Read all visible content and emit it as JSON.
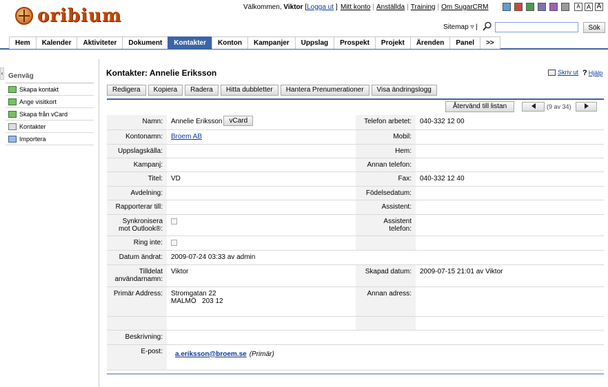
{
  "header": {
    "logo_text": "oribium",
    "welcome_prefix": "Välkommen,",
    "user": "Viktor",
    "logout_open": "[",
    "logout_label": "Logga ut",
    "logout_close": "]",
    "top_links": [
      "Mitt konto",
      "Anställda",
      "Training",
      "Om SugarCRM"
    ],
    "swatches": [
      "#5b9ed6",
      "#c9493f",
      "#4b9a4b",
      "#7e74b4",
      "#9c63b5",
      "#9a9a9a"
    ],
    "font_sizes": [
      "A",
      "A",
      "A"
    ],
    "sitemap_label": "Sitemap",
    "sitemap_arrow": "▿ |",
    "search_placeholder": "",
    "search_button": "Sök"
  },
  "tabs": [
    "Hem",
    "Kalender",
    "Aktiviteter",
    "Dokument",
    "Kontakter",
    "Konton",
    "Kampanjer",
    "Uppslag",
    "Prospekt",
    "Projekt",
    "Ärenden",
    "Panel",
    ">>"
  ],
  "active_tab": "Kontakter",
  "sidebar": {
    "title": "Genväg",
    "items": [
      {
        "label": "Skapa kontakt",
        "icon": "add-contact-icon"
      },
      {
        "label": "Ange visitkort",
        "icon": "business-card-icon"
      },
      {
        "label": "Skapa från vCard",
        "icon": "vcard-import-icon"
      },
      {
        "label": "Kontakter",
        "icon": "contacts-list-icon"
      },
      {
        "label": "Importera",
        "icon": "import-icon"
      }
    ]
  },
  "main": {
    "title": "Kontakter: Annelie Eriksson",
    "print_label": "Skriv ut",
    "help_label": "Hjälp",
    "actions": [
      "Redigera",
      "Kopiera",
      "Radera",
      "Hitta dubbletter",
      "Hantera Prenumerationer",
      "Visa ändringslogg"
    ],
    "return_button": "Återvänd till listan",
    "record_counter": "(9 av 34)",
    "vcard_button": "vCard"
  },
  "fields": {
    "name_label": "Namn:",
    "name_value": "Annelie Eriksson",
    "phone_work_label": "Telefon arbetet:",
    "phone_work_value": "040-332 12 00",
    "account_label": "Kontonamn:",
    "account_value": "Broem AB",
    "mobile_label": "Mobil:",
    "lead_source_label": "Uppslagskälla:",
    "home_label": "Hem:",
    "campaign_label": "Kampanj:",
    "other_phone_label": "Annan telefon:",
    "title_label": "Titel:",
    "title_value": "VD",
    "fax_label": "Fax:",
    "fax_value": "040-332 12 40",
    "department_label": "Avdelning:",
    "birthdate_label": "Födelsedatum:",
    "reports_to_label": "Rapporterar till:",
    "assistant_label": "Assistent:",
    "sync_label": "Synkronisera mot Outlook®:",
    "assistant_phone_label": "Assistent telefon:",
    "do_not_call_label": "Ring inte:",
    "modified_label": "Datum ändrat:",
    "modified_value": "2009-07-24 03:33 av admin",
    "assigned_label": "Tilldelat användarnamn:",
    "assigned_value": "Viktor",
    "created_label": "Skapad datum:",
    "created_value": "2009-07-15 21:01 av Viktor",
    "primary_address_label": "Primär Address:",
    "primary_address_line1": "Stromgatan 22",
    "primary_address_line2": "MALMÖ   203 12",
    "other_address_label": "Annan adress:",
    "description_label": "Beskrivning:",
    "email_label": "E-post:",
    "email_value": "a.eriksson@broem.se",
    "email_note": "(Primär)"
  }
}
